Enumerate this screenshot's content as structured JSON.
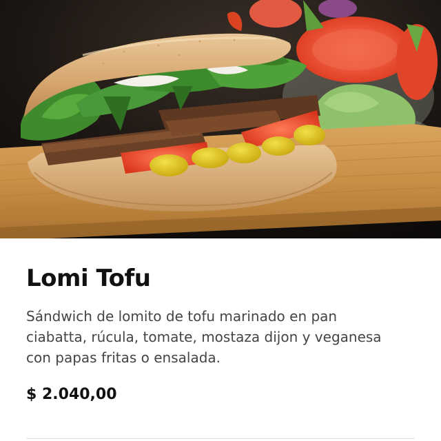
{
  "product": {
    "image_subject": "tofu-sandwich-photo",
    "name": "Lomi Tofu",
    "description": "Sándwich de lomito de tofu marinado en pan ciabatta, rúcula, tomate, mostaza dijon y veganesa con papas fritas o ensalada.",
    "price": "$ 2.040,00"
  },
  "colors": {
    "title": "#111111",
    "description": "#444444",
    "price": "#111111",
    "divider": "#e2e2e2"
  }
}
